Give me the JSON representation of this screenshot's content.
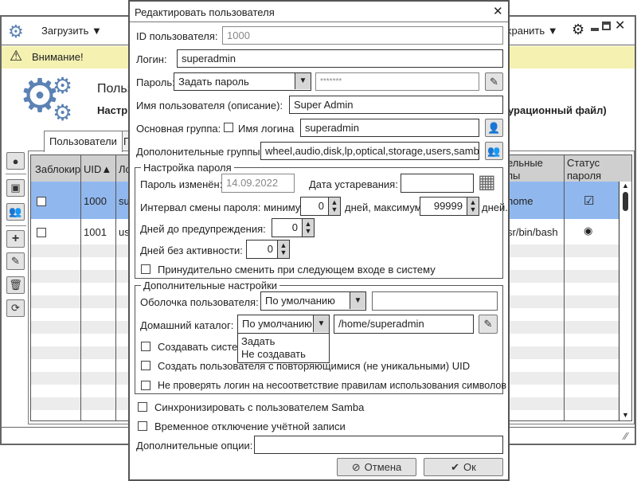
{
  "app": {
    "toolbar": {
      "load_label": "Загрузить",
      "save_label": "хранить"
    },
    "warning": "Внимание!",
    "header": {
      "title": "Польз",
      "subtitle": "Настр",
      "subtitle_tail": "урационный файл)"
    },
    "tabs": [
      {
        "label": "Пользователи",
        "active": true
      },
      {
        "label": "Г"
      }
    ],
    "table": {
      "headers": [
        "Заблокир",
        "UID",
        "Ло",
        "ельные\nпы",
        "Статус\nпароля"
      ],
      "sort_indicator": "▲",
      "rows": [
        {
          "locked": false,
          "uid": "1000",
          "login": "su",
          "extra": "home",
          "status": "checked",
          "selected": true
        },
        {
          "locked": false,
          "uid": "1001",
          "login": "us",
          "extra": "sr/bin/bash",
          "status": "radio",
          "selected": false
        }
      ]
    },
    "side_tools": [
      "penguin-icon",
      "contact-icon",
      "users-icon",
      "plus-icon",
      "edit-icon",
      "trash-icon",
      "refresh-icon"
    ],
    "colors": {
      "accent": "#5b82b3",
      "selected_row": "#91b8ee",
      "warning_bg": "#f4f1b1"
    }
  },
  "dialog": {
    "title": "Редактировать пользователя",
    "uid_label": "ID пользователя:",
    "uid_value": "1000",
    "login_label": "Логин:",
    "login_value": "superadmin",
    "password_label": "Пароль:",
    "password_mode": "Задать пароль",
    "password_value": "*******",
    "fullname_label": "Имя пользователя (описание):",
    "fullname_value": "Super Admin",
    "primary_group_label": "Основная группа:",
    "login_name_checkbox": "Имя логина",
    "login_name_checked": false,
    "primary_group_value": "superadmin",
    "extra_groups_label": "Дополонительные группы:",
    "extra_groups_value": "wheel,audio,disk,lp,optical,storage,users,samb",
    "password_settings": {
      "legend": "Настройка пароля",
      "changed_label": "Пароль изменён:",
      "changed_value": "14.09.2022",
      "expire_label": "Дата устаревания:",
      "expire_value": "",
      "interval_label": "Интервал смены пароля: минимум",
      "min_value": "0",
      "days_max_label": "дней, максимум",
      "max_value": "99999",
      "days_label": "дней.",
      "warn_label": "Дней до предупреждения:",
      "warn_value": "0",
      "inactive_label": "Дней без активности:",
      "inactive_value": "0",
      "force_change_label": "Принудительно сменить при следующем входе в систему",
      "force_change_checked": false
    },
    "extra_settings": {
      "legend": "Дополнительные настройки",
      "shell_label": "Оболочка пользователя:",
      "shell_mode": "По умолчанию",
      "shell_value": "",
      "home_label": "Домашний каталог:",
      "home_mode": "По умолчанию",
      "home_value": "/home/superadmin",
      "home_options": [
        "Задать",
        "Не создавать"
      ],
      "create_system_label": "Создавать систем",
      "non_unique_label": "Создать пользователя с повторяющимися (не уникальными) UID",
      "no_check_label": "Не проверять логин на несоответствие правилам использования символов"
    },
    "samba_label": "Синхронизировать с пользователем Samba",
    "disable_label": "Временное отключение учётной записи",
    "options_label": "Дополнительные опции:",
    "options_value": "",
    "cancel_label": "Отмена",
    "ok_label": "Ок"
  }
}
